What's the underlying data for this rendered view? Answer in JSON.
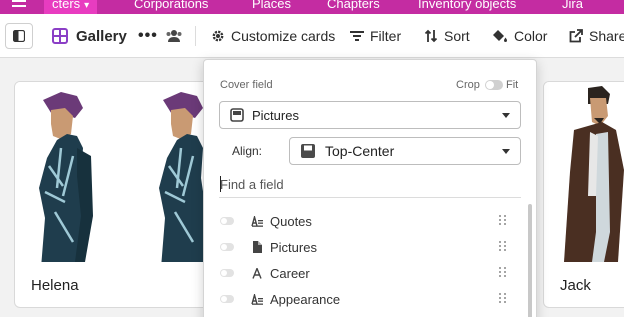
{
  "tabs": [
    {
      "label": "cters",
      "active": true
    },
    {
      "label": "Corporations"
    },
    {
      "label": "Places"
    },
    {
      "label": "Chapters"
    },
    {
      "label": "Inventory objects"
    },
    {
      "label": "Jira"
    }
  ],
  "toolbar": {
    "view_label": "Gallery",
    "more_label": "•••",
    "customize_label": "Customize cards",
    "filter_label": "Filter",
    "sort_label": "Sort",
    "color_label": "Color",
    "share_label": "Share"
  },
  "cards": [
    {
      "name": "Helena"
    },
    {
      "name": "Jack"
    }
  ],
  "panel": {
    "cover_field_label": "Cover field",
    "crop_label": "Crop",
    "fit_label": "Fit",
    "cover_value": "Pictures",
    "align_label": "Align:",
    "align_value": "Top-Center",
    "find_placeholder": "Find a field",
    "fields": [
      {
        "label": "Quotes",
        "icon": "long-text-icon"
      },
      {
        "label": "Pictures",
        "icon": "attachment-file-icon"
      },
      {
        "label": "Career",
        "icon": "single-line-text-icon"
      },
      {
        "label": "Appearance",
        "icon": "long-text-icon"
      }
    ]
  },
  "colors": {
    "tabbar": "#c42ca2",
    "active_tab": "#e83cc0",
    "gallery_icon": "#8b3fc6"
  }
}
